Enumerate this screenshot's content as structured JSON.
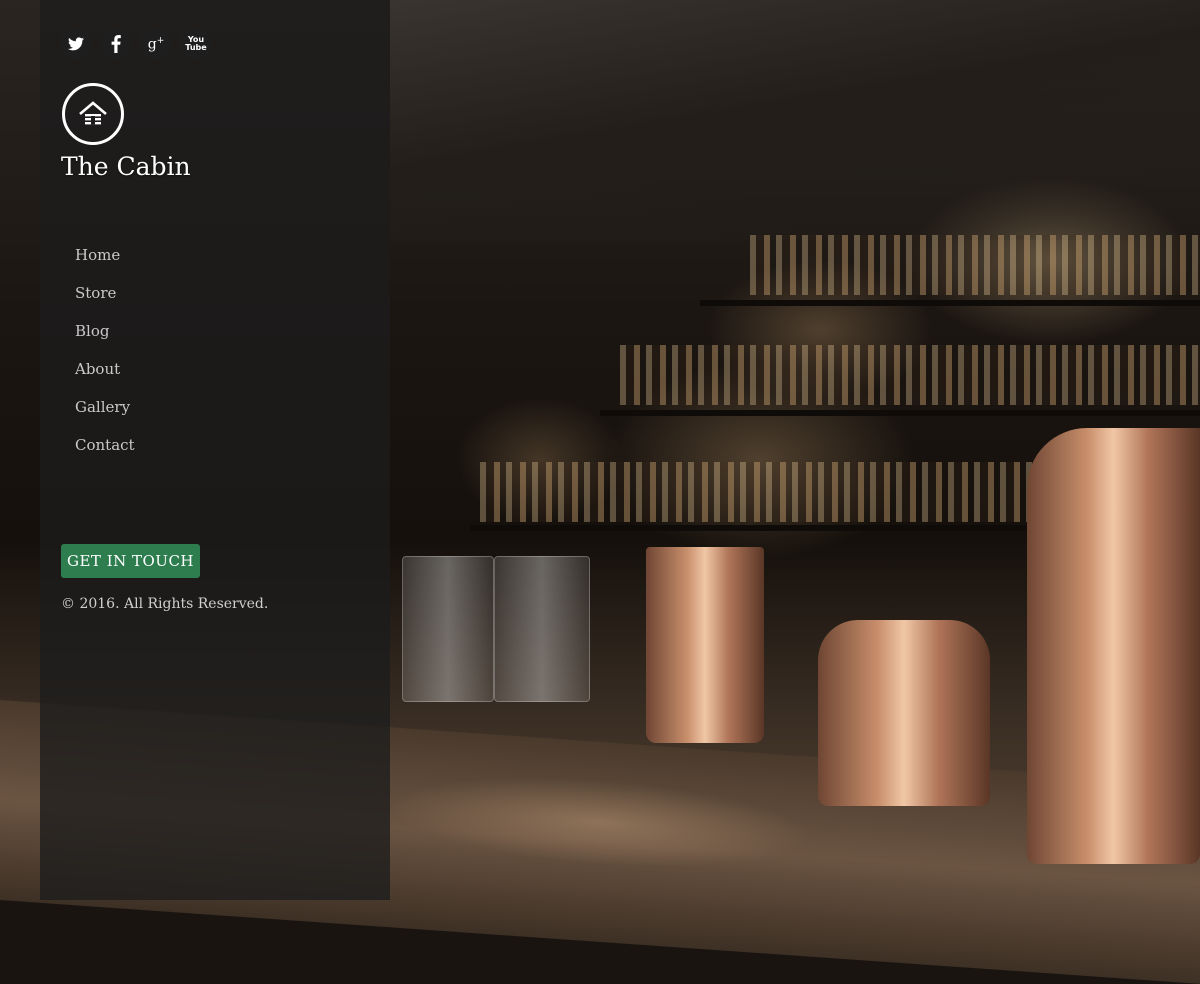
{
  "site": {
    "title": "The Cabin"
  },
  "social": [
    {
      "name": "twitter-icon",
      "glyph": "🐦"
    },
    {
      "name": "facebook-icon",
      "glyph": "f"
    },
    {
      "name": "google-plus-icon",
      "glyph": "g+"
    },
    {
      "name": "youtube-icon",
      "glyph": "You Tube"
    }
  ],
  "nav": {
    "items": [
      "Home",
      "Store",
      "Blog",
      "About",
      "Gallery",
      "Contact"
    ]
  },
  "cta": {
    "label": "GET IN TOUCH"
  },
  "footer": {
    "copyright": "© 2016. All Rights Reserved."
  },
  "colors": {
    "accent": "#2e7d4f",
    "sidebar_bg": "#1c1c1c"
  }
}
